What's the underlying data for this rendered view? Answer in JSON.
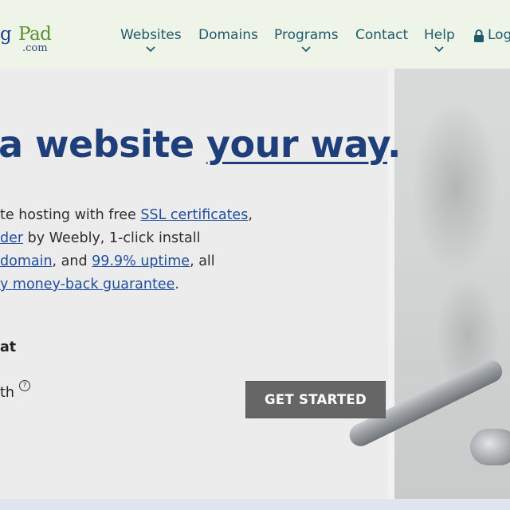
{
  "logo": {
    "left_text": "g",
    "pad_text": "Pad",
    "dotcom": ".com"
  },
  "nav": {
    "items": [
      {
        "label": "Websites",
        "has_dropdown": true
      },
      {
        "label": "Domains",
        "has_dropdown": false
      },
      {
        "label": "Programs",
        "has_dropdown": true
      },
      {
        "label": "Contact",
        "has_dropdown": false
      },
      {
        "label": "Help",
        "has_dropdown": true
      }
    ],
    "login_label": "Log"
  },
  "hero": {
    "headline_plain": "a website ",
    "headline_emph": "your way",
    "headline_end": ".",
    "para_line1_text": "te hosting with free ",
    "para_line1_link": "SSL certificates",
    "para_line1_end": ",",
    "para_line2_link": "der",
    "para_line2_text": " by Weebly, 1-click install",
    "para_line3_link": "domain",
    "para_line3_mid": ", and ",
    "para_line3_link2": "99.9% uptime",
    "para_line3_end": ", all",
    "para_line4_link": "y money-back guarantee",
    "para_line4_end": ".",
    "bold_label": "at",
    "sub_label": "th",
    "help_glyph": "?",
    "cta_label": "GET STARTED"
  },
  "colors": {
    "header_bg": "#eef5e8",
    "nav_text": "#1f5a6b",
    "headline": "#1e3f7a",
    "link": "#1f4e9c",
    "cta_bg": "#666666"
  }
}
